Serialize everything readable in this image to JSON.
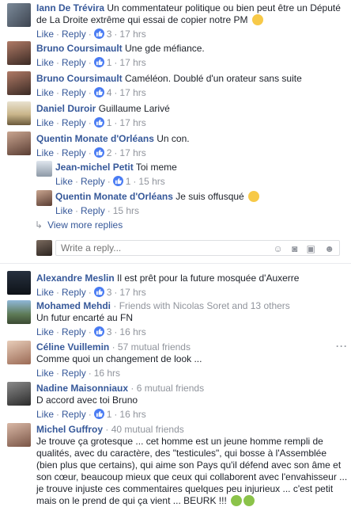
{
  "labels": {
    "like": "Like",
    "reply": "Reply",
    "dot": "·"
  },
  "comments": [
    {
      "name": "Iann De Trévira",
      "text": "Un commentateur politique ou bien peut être un Député de La Droite extrême qui essai de copier notre PM",
      "likes": "3",
      "time": "17 hrs",
      "emoji": "laughing-face"
    },
    {
      "name": "Bruno Coursimault",
      "text": "Une gde méfiance.",
      "likes": "1",
      "time": "17 hrs"
    },
    {
      "name": "Bruno Coursimault",
      "text": "Caméléon. Doublé d'un orateur sans suite",
      "likes": "4",
      "time": "17 hrs"
    },
    {
      "name": "Daniel Duroir",
      "text": "Guillaume Larivé",
      "likes": "1",
      "time": "17 hrs"
    },
    {
      "name": "Quentin Monate d'Orléans",
      "text": "Un con.",
      "likes": "2",
      "time": "17 hrs"
    }
  ],
  "replies": [
    {
      "name": "Jean-michel Petit",
      "text": "Toi meme",
      "likes": "1",
      "time": "15 hrs"
    },
    {
      "name": "Quentin Monate d'Orléans",
      "text": "Je suis offusqué",
      "time": "15 hrs",
      "emoji": "astonished-face"
    }
  ],
  "view_more": "View more replies",
  "reply_box": {
    "placeholder": "Write a reply..."
  },
  "comments2": [
    {
      "name": "Alexandre Meslin",
      "text": "Il est prêt pour la future mosquée d'Auxerre",
      "likes": "3",
      "time": "17 hrs"
    },
    {
      "name": "Mohamed Mehdi",
      "sub": "· Friends with Nicolas Soret and 13 others",
      "text": "Un futur encarté au FN",
      "likes": "3",
      "time": "16 hrs"
    },
    {
      "name": "Céline Vuillemin",
      "sub": "· 57 mutual friends",
      "text": "Comme quoi un changement de look ...",
      "time": "16 hrs"
    },
    {
      "name": "Nadine Maisonniaux",
      "sub": "· 6 mutual friends",
      "text": "D accord avec toi Bruno",
      "likes": "1",
      "time": "16 hrs"
    },
    {
      "name": "Michel Guffroy",
      "sub": "· 40 mutual friends",
      "text": "Je trouve ça grotesque ... cet homme est un jeune homme rempli de qualités, avec du caractère, des \"testicules\", qui bosse à l'Assemblée (bien plus que certains), qui aime son Pays qu'il défend avec son âme et son cœur, beaucoup mieux que ceux qui collaborent avec l'envahisseur ...",
      "text2": "je trouve injuste ces commentaires quelques peu injurieux ... c'est petit mais on le prend de qui ça vient ... BEURK !!!",
      "emoji": "nauseated-face"
    }
  ],
  "options_glyph": "···",
  "colors": {
    "name": "#365899",
    "meta": "#90949c",
    "text": "#1d2129",
    "like_badge": "#4a7cf3"
  }
}
